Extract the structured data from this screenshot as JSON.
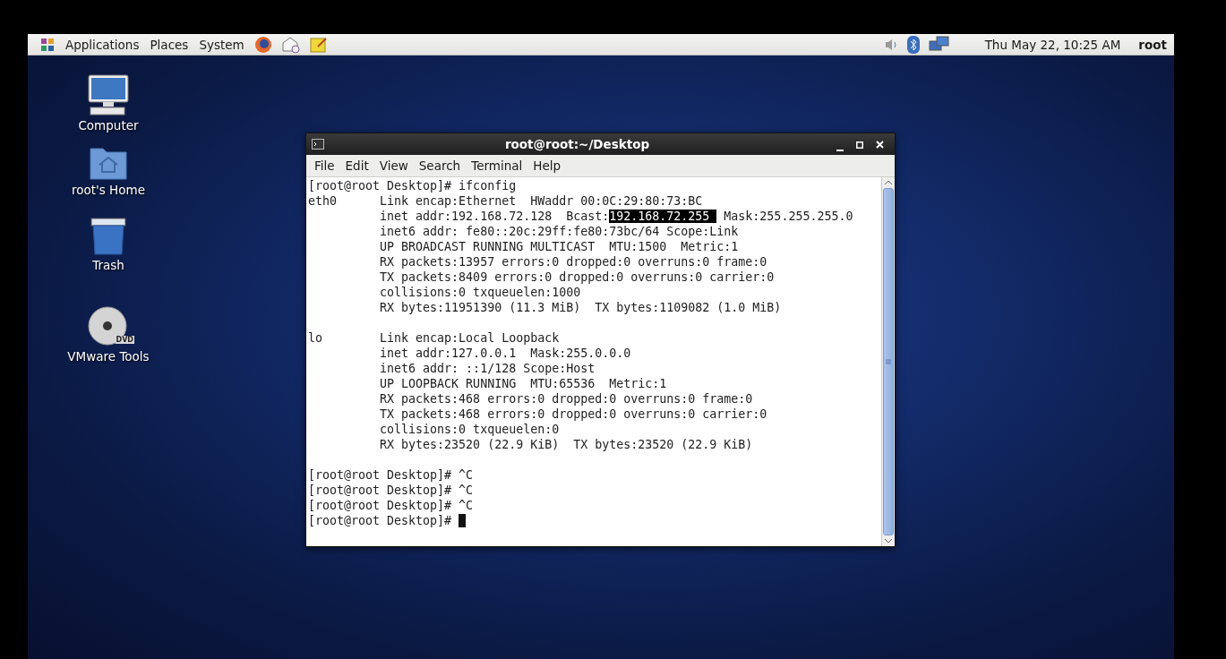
{
  "panel": {
    "menus": [
      "Applications",
      "Places",
      "System"
    ],
    "clock": "Thu May 22, 10:25 AM",
    "user": "root"
  },
  "desktop_icons": [
    {
      "kind": "computer",
      "label": "Computer"
    },
    {
      "kind": "home",
      "label": "root's Home"
    },
    {
      "kind": "trash",
      "label": "Trash"
    },
    {
      "kind": "dvd",
      "label": "VMware Tools",
      "badge": "DVD"
    }
  ],
  "terminal": {
    "title": "root@root:~/Desktop",
    "menu": [
      "File",
      "Edit",
      "View",
      "Search",
      "Terminal",
      "Help"
    ],
    "lines": [
      {
        "kind": "text",
        "segments": [
          {
            "text": "[root@root Desktop]# ifconfig",
            "selected": false
          }
        ]
      },
      {
        "kind": "text",
        "segments": [
          {
            "text": "eth0      Link encap:Ethernet  HWaddr 00:0C:29:80:73:BC",
            "selected": false
          }
        ]
      },
      {
        "kind": "text",
        "segments": [
          {
            "text": "          inet addr:192.168.72.128  Bcast:",
            "selected": false
          },
          {
            "text": "192.168.72.255 ",
            "selected": true
          },
          {
            "text": " Mask:255.255.255.0",
            "selected": false
          }
        ]
      },
      {
        "kind": "text",
        "segments": [
          {
            "text": "          inet6 addr: fe80::20c:29ff:fe80:73bc/64 Scope:Link",
            "selected": false
          }
        ]
      },
      {
        "kind": "text",
        "segments": [
          {
            "text": "          UP BROADCAST RUNNING MULTICAST  MTU:1500  Metric:1",
            "selected": false
          }
        ]
      },
      {
        "kind": "text",
        "segments": [
          {
            "text": "          RX packets:13957 errors:0 dropped:0 overruns:0 frame:0",
            "selected": false
          }
        ]
      },
      {
        "kind": "text",
        "segments": [
          {
            "text": "          TX packets:8409 errors:0 dropped:0 overruns:0 carrier:0",
            "selected": false
          }
        ]
      },
      {
        "kind": "text",
        "segments": [
          {
            "text": "          collisions:0 txqueuelen:1000",
            "selected": false
          }
        ]
      },
      {
        "kind": "text",
        "segments": [
          {
            "text": "          RX bytes:11951390 (11.3 MiB)  TX bytes:1109082 (1.0 MiB)",
            "selected": false
          }
        ]
      },
      {
        "kind": "blank"
      },
      {
        "kind": "text",
        "segments": [
          {
            "text": "lo        Link encap:Local Loopback",
            "selected": false
          }
        ]
      },
      {
        "kind": "text",
        "segments": [
          {
            "text": "          inet addr:127.0.0.1  Mask:255.0.0.0",
            "selected": false
          }
        ]
      },
      {
        "kind": "text",
        "segments": [
          {
            "text": "          inet6 addr: ::1/128 Scope:Host",
            "selected": false
          }
        ]
      },
      {
        "kind": "text",
        "segments": [
          {
            "text": "          UP LOOPBACK RUNNING  MTU:65536  Metric:1",
            "selected": false
          }
        ]
      },
      {
        "kind": "text",
        "segments": [
          {
            "text": "          RX packets:468 errors:0 dropped:0 overruns:0 frame:0",
            "selected": false
          }
        ]
      },
      {
        "kind": "text",
        "segments": [
          {
            "text": "          TX packets:468 errors:0 dropped:0 overruns:0 carrier:0",
            "selected": false
          }
        ]
      },
      {
        "kind": "text",
        "segments": [
          {
            "text": "          collisions:0 txqueuelen:0",
            "selected": false
          }
        ]
      },
      {
        "kind": "text",
        "segments": [
          {
            "text": "          RX bytes:23520 (22.9 KiB)  TX bytes:23520 (22.9 KiB)",
            "selected": false
          }
        ]
      },
      {
        "kind": "blank"
      },
      {
        "kind": "text",
        "segments": [
          {
            "text": "[root@root Desktop]# ^C",
            "selected": false
          }
        ]
      },
      {
        "kind": "text",
        "segments": [
          {
            "text": "[root@root Desktop]# ^C",
            "selected": false
          }
        ]
      },
      {
        "kind": "text",
        "segments": [
          {
            "text": "[root@root Desktop]# ^C",
            "selected": false
          }
        ]
      },
      {
        "kind": "text",
        "segments": [
          {
            "text": "[root@root Desktop]# ",
            "selected": false
          }
        ]
      }
    ],
    "cursor": true
  }
}
